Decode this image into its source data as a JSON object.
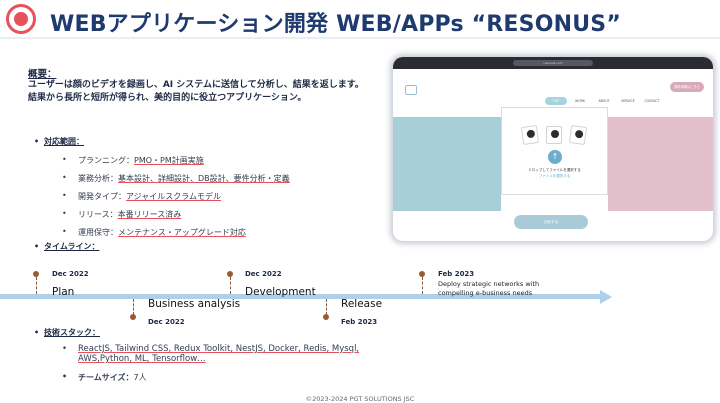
{
  "header": {
    "title": "WEBアプリケーション開発 WEB/APPs “RESONUS”"
  },
  "overview": {
    "label": "概要：",
    "line1": "ユーザーは顔のビデオを録画し、AI システムに送信して分析し、結果を返します。",
    "line2": "結果から長所と短所が得られ、美的目的に役立つアプリケーション。"
  },
  "scope": {
    "label": "対応範囲：",
    "items": [
      {
        "name": "プランニング",
        "value": "PMO・PM計画実施"
      },
      {
        "name": "業務分析",
        "value": "基本設計、詳細設計、DB設計、要件分析・定義"
      },
      {
        "name": "開発タイプ",
        "value": "アジャイルスクラムモデル"
      },
      {
        "name": "リリース",
        "value": "本番リリース済み"
      },
      {
        "name": "運用保守",
        "value": "メンテナンス・アップグレード対応"
      }
    ]
  },
  "timeline": {
    "label": "タイムライン：",
    "events": [
      {
        "date": "Dec 2022",
        "phase": "Plan",
        "side": "top"
      },
      {
        "date": "Dec 2022",
        "phase": "Business analysis",
        "side": "bottom"
      },
      {
        "date": "Dec 2022",
        "phase": "Development",
        "side": "top"
      },
      {
        "date": "Feb 2023",
        "phase": "Release",
        "side": "bottom"
      },
      {
        "date": "Feb 2023",
        "phase": "",
        "side": "top",
        "desc_line1": "Deploy strategic networks with",
        "desc_line2": "compelling e-business needs"
      }
    ]
  },
  "tech": {
    "label": "技術スタック：",
    "stack_parts": [
      "ReactJS",
      "Tailwind CSS",
      "Redux Toolkit",
      "NestJS",
      "Docker",
      "Redis",
      "Mysql",
      "AWS",
      "Python",
      "ML",
      "Tensorflow"
    ],
    "line1_text": "ReactJS, Tailwind CSS, Redux Toolkit, NestJS, Docker, Redis, Mysql,",
    "line2_text": "AWS,Python, ML, Tensorflow…",
    "team_label": "チームサイズ：",
    "team_value": "7人"
  },
  "screenshot": {
    "address": "resonus.com",
    "nav": [
      "TOP",
      "WORK",
      "ABOUT",
      "SERVICE",
      "CONTACT"
    ],
    "cta": "無料体験はこちら",
    "drop_text": "ドロップしてファイルを選択する",
    "pick_text": "ファイルを選択する",
    "analyze_button": "分析する",
    "colors": {
      "blue_band": "#a7cfd8",
      "pink_band": "#e3bfcc",
      "accent": "#6aaecb"
    }
  },
  "footer": {
    "copyright": "©2023-2024 PGT SOLUTIONS JSC"
  },
  "theme": {
    "title_color": "#1e3a6e",
    "underline_accent": "#e8505b",
    "timeline_axis": "#aed0ea",
    "milestone_dot": "#9a5a35"
  }
}
